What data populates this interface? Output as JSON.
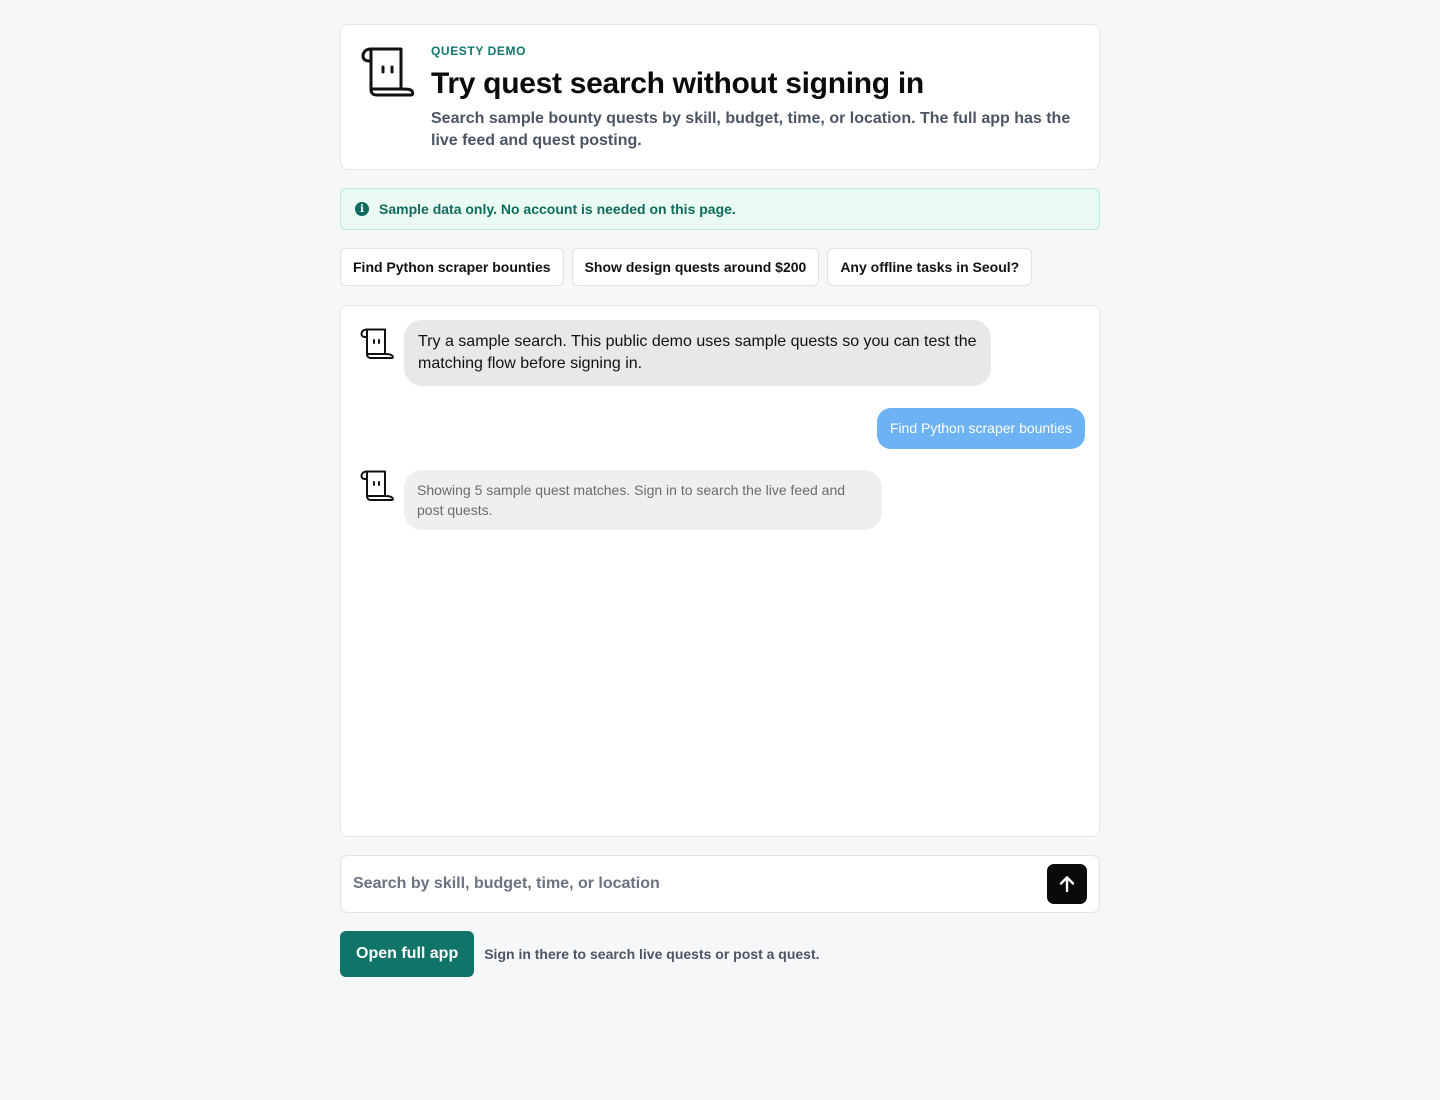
{
  "hero": {
    "eyebrow": "QUESTY DEMO",
    "title": "Try quest search without signing in",
    "description": "Search sample bounty quests by skill, budget, time, or location. The full app has the live feed and quest posting."
  },
  "notice": {
    "icon": "info-icon",
    "text": "Sample data only. No account is needed on this page."
  },
  "suggestions": [
    "Find Python scraper bounties",
    "Show design quests around $200",
    "Any offline tasks in Seoul?"
  ],
  "messages": [
    {
      "role": "assistant",
      "text": "Try a sample search. This public demo uses sample quests so you can test the matching flow before signing in."
    },
    {
      "role": "user",
      "text": "Find Python scraper bounties"
    },
    {
      "role": "assistant",
      "text": "Showing 5 sample quest matches. Sign in to search the live feed and post quests."
    }
  ],
  "search": {
    "placeholder": "Search by skill, budget, time, or location",
    "value": "",
    "send_icon": "arrow-up-icon"
  },
  "footer": {
    "button_label": "Open full app",
    "note": "Sign in there to search live quests or post a quest."
  },
  "colors": {
    "accent": "#117468",
    "user_bubble": "#6cb2f5",
    "notice_bg": "#e9fbf3"
  }
}
